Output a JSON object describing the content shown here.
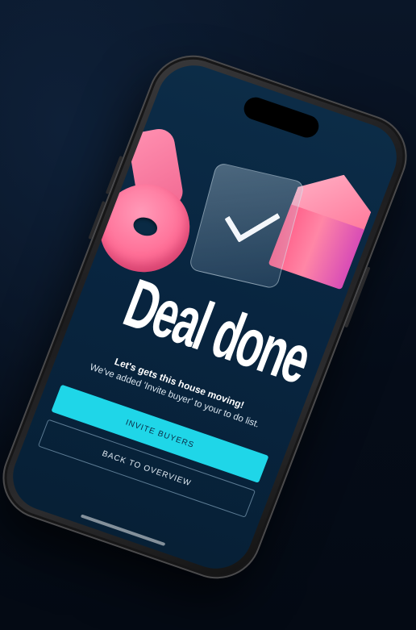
{
  "screen": {
    "headline": "Deal done",
    "subtitle": "Let's gets this house moving!",
    "body": "We've added 'Invite buyer' to your to do list.",
    "primary_button": "INVITE BUYERS",
    "secondary_button": "BACK TO OVERVIEW"
  },
  "colors": {
    "background": "#07101f",
    "screen_bg": "#0a2a44",
    "primary_button": "#1fd6e8",
    "accent_pink": "#ff6f97"
  },
  "icons": {
    "key": "key-icon",
    "check": "checkmark-icon",
    "house": "house-icon"
  }
}
